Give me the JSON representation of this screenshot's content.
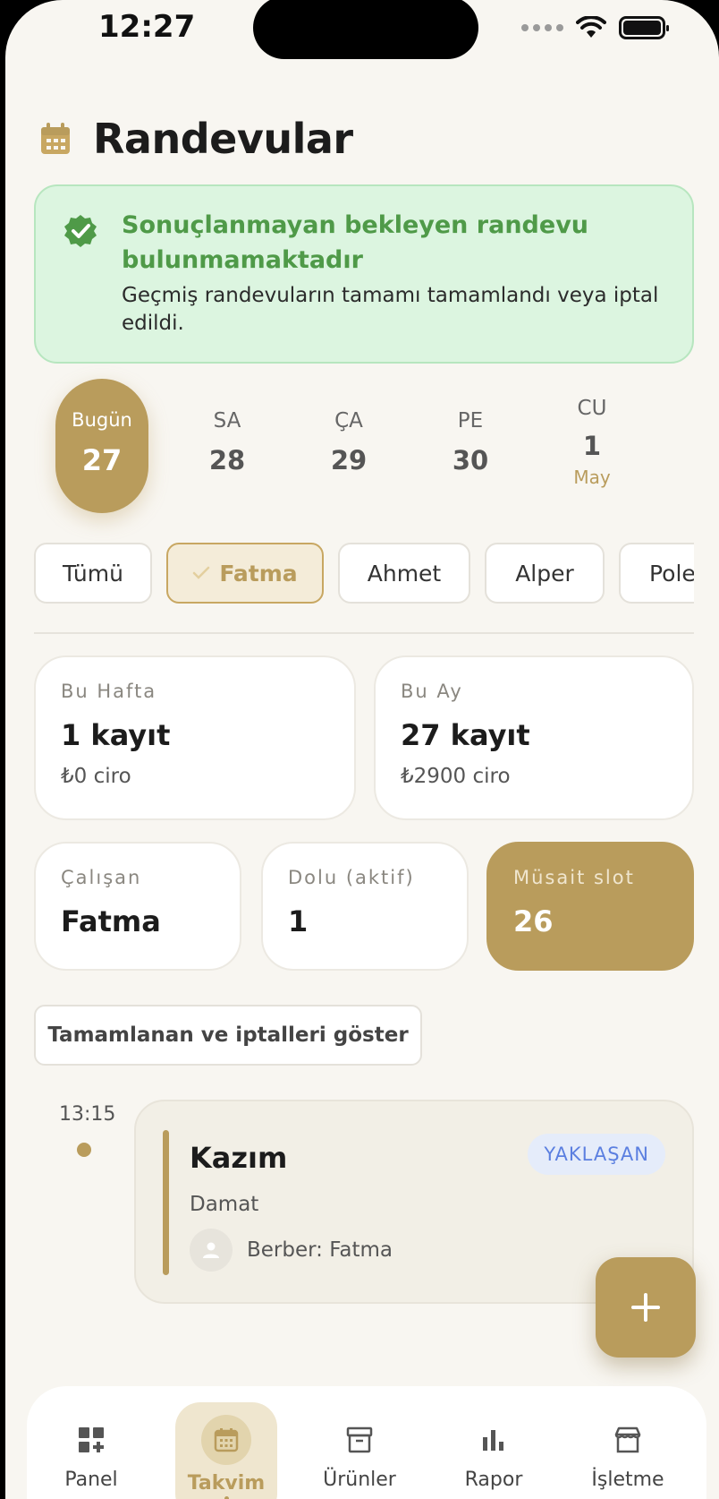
{
  "status": {
    "time": "12:27"
  },
  "header": {
    "title": "Randevular"
  },
  "alert": {
    "title": "Sonuçlanmayan bekleyen randevu bulunmamaktadır",
    "text": "Geçmiş randevuların tamamı tamamlandı veya iptal edildi."
  },
  "days": [
    {
      "name": "Bugün",
      "num": "27"
    },
    {
      "name": "SA",
      "num": "28"
    },
    {
      "name": "ÇA",
      "num": "29"
    },
    {
      "name": "PE",
      "num": "30"
    },
    {
      "name": "CU",
      "num": "1",
      "month": "May"
    }
  ],
  "filters": [
    "Tümü",
    "Fatma",
    "Ahmet",
    "Alper",
    "Pole"
  ],
  "stats": {
    "week": {
      "label": "Bu Hafta",
      "count": "1 kayıt",
      "revenue": "₺0 ciro"
    },
    "month": {
      "label": "Bu Ay",
      "count": "27 kayıt",
      "revenue": "₺2900 ciro"
    },
    "employee": {
      "label": "Çalışan",
      "value": "Fatma"
    },
    "busy": {
      "label": "Dolu (aktif)",
      "value": "1"
    },
    "available": {
      "label": "Müsait slot",
      "value": "26"
    }
  },
  "toggle_label": "Tamamlanan ve iptalleri göster",
  "appointment": {
    "time": "13:15",
    "name": "Kazım",
    "status": "YAKLAŞAN",
    "service": "Damat",
    "staff": "Berber: Fatma"
  },
  "tabs": [
    "Panel",
    "Takvim",
    "Ürünler",
    "Rapor",
    "İşletme"
  ],
  "colors": {
    "accent": "#b99c5c",
    "success": "#4f9a48",
    "badge": "#5b7fe0"
  }
}
